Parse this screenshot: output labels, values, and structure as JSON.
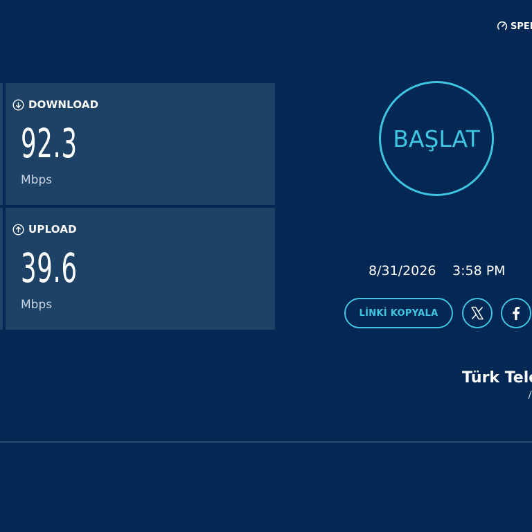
{
  "header": {
    "brand_text": "SPEEDTEST",
    "brand_icon": "speedometer-icon"
  },
  "metrics": {
    "download": {
      "label": "DOWNLOAD",
      "value": "92.3",
      "unit": "Mbps",
      "icon": "download-arrow-icon"
    },
    "upload": {
      "label": "UPLOAD",
      "value": "39.6",
      "unit": "Mbps",
      "icon": "upload-arrow-icon"
    }
  },
  "start": {
    "label": "BAŞLAT"
  },
  "result": {
    "date": "8/31/2026",
    "time": "3:58 PM"
  },
  "share": {
    "copy_link_label": "LİNKİ KOPYALA",
    "x_icon": "x-logo-icon",
    "facebook_icon": "facebook-icon"
  },
  "isp": {
    "name": "Türk Telekom"
  },
  "colors": {
    "background": "#022853",
    "card": "#1d4266",
    "accent": "#3fc5e1",
    "text": "#ffffff",
    "muted_text": "#c6d2e0"
  }
}
